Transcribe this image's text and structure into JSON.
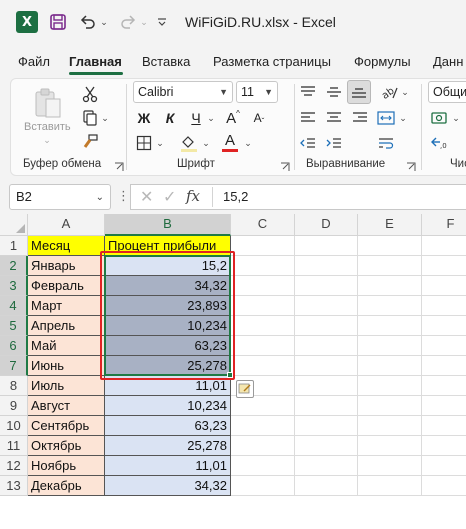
{
  "app": {
    "logo_letter": "X",
    "title": "WiFiGiD.RU.xlsx  -  Excel"
  },
  "menu": {
    "tabs": [
      "Файл",
      "Главная",
      "Вставка",
      "Разметка страницы",
      "Формулы",
      "Данн"
    ],
    "active_index": 1
  },
  "ribbon": {
    "clipboard": {
      "paste_label": "Вставить",
      "group_label": "Буфер обмена"
    },
    "font": {
      "font_name": "Calibri",
      "font_size": "11",
      "bold": "Ж",
      "italic": "К",
      "underline": "Ч",
      "grow": "A",
      "shrink": "A",
      "color_letter": "A",
      "group_label": "Шрифт"
    },
    "alignment": {
      "group_label": "Выравнивание"
    },
    "number": {
      "format": "Общи",
      "group_label": "Чис"
    }
  },
  "formula_bar": {
    "name_box": "B2",
    "dots": "⋮",
    "cancel": "✕",
    "enter": "✓",
    "fx": "fx",
    "value": "15,2"
  },
  "sheet": {
    "columns": [
      "A",
      "B",
      "C",
      "D",
      "E",
      "F"
    ],
    "rows": [
      "1",
      "2",
      "3",
      "4",
      "5",
      "6",
      "7",
      "8",
      "9",
      "10",
      "11",
      "12",
      "13"
    ],
    "header_a": "Месяц",
    "header_b": "Процент прибыли",
    "months": [
      "Январь",
      "Февраль",
      "Март",
      "Апрель",
      "Май",
      "Июнь",
      "Июль",
      "Август",
      "Сентябрь",
      "Октябрь",
      "Ноябрь",
      "Декабрь"
    ],
    "values": [
      "15,2",
      "34,32",
      "23,893",
      "10,234",
      "63,23",
      "25,278",
      "11,01",
      "10,234",
      "63,23",
      "25,278",
      "11,01",
      "34,32"
    ]
  },
  "colors": {
    "accent": "#1d6f42",
    "header_fill": "#ffff00",
    "month_fill": "#fce4d6",
    "value_fill": "#dae3f3",
    "selected_fill": "#a8b1c4",
    "highlight": "#e02323"
  }
}
